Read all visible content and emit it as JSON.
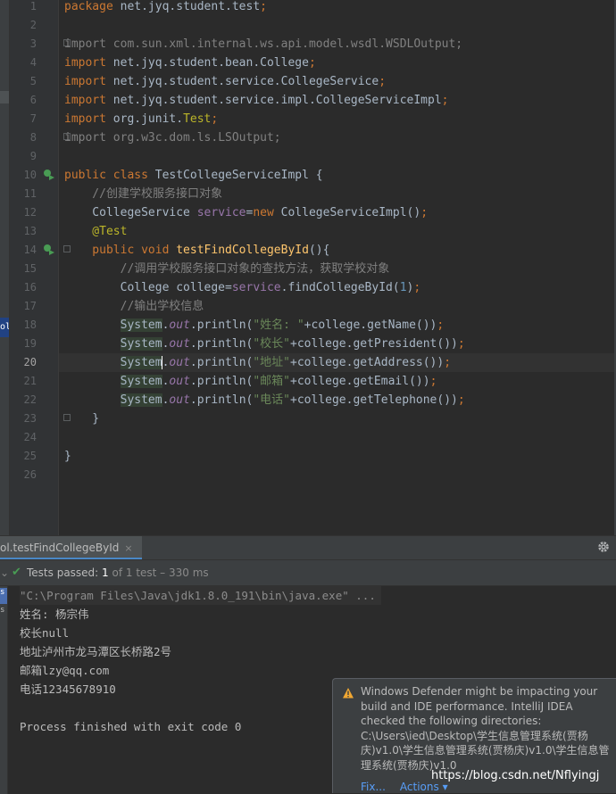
{
  "editor": {
    "line_numbers": [
      "1",
      "2",
      "3",
      "4",
      "5",
      "6",
      "7",
      "8",
      "9",
      "10",
      "11",
      "12",
      "13",
      "14",
      "15",
      "16",
      "17",
      "18",
      "19",
      "20",
      "21",
      "22",
      "23",
      "24",
      "25",
      "26"
    ],
    "current_line": "20",
    "code": {
      "l1_kw": "package",
      "l1_rest": " net.jyq.student.test",
      "l1_semi": ";",
      "l3_kw": "import",
      "l3_rest": " com.sun.xml.internal.ws.api.model.wsdl.WSDLOutput;",
      "l4_kw": "import",
      "l4_rest": " net.jyq.student.bean.College",
      "l4_semi": ";",
      "l5_kw": "import",
      "l5_rest": " net.jyq.student.service.CollegeService",
      "l5_semi": ";",
      "l6_kw": "import",
      "l6_rest": " net.jyq.student.service.impl.CollegeServiceImpl",
      "l6_semi": ";",
      "l7_kw": "import",
      "l7_rest": " org.junit.",
      "l7_ann": "Test",
      "l7_semi": ";",
      "l8_kw": "import",
      "l8_rest": " org.w3c.dom.ls.LSOutput;",
      "l10_kw": "public class",
      "l10_rest": " TestCollegeServiceImpl {",
      "l11_cmt": "    //创建学校服务接口对象",
      "l12_a": "    CollegeService ",
      "l12_fld": "service",
      "l12_b": "=",
      "l12_kw": "new",
      "l12_c": " CollegeServiceImpl()",
      "l12_semi": ";",
      "l13_ann": "    @Test",
      "l14_kw": "    public void",
      "l14_sp": " ",
      "l14_fn": "testFindCollegeById",
      "l14_rest": "(){",
      "l15_cmt": "        //调用学校服务接口对象的查找方法，获取学校对象",
      "l16_a": "        College college=",
      "l16_fld": "service",
      "l16_b": ".findCollegeById(",
      "l16_num": "1",
      "l16_c": ")",
      "l16_semi": ";",
      "l17_cmt": "        //输出学校信息",
      "l18_ind": "        ",
      "l18_sys": "System",
      "l18_dot": ".",
      "l18_out": "out",
      "l18_a": ".println(",
      "l18_str": "\"姓名: \"",
      "l18_b": "+college.getName())",
      "l18_semi": ";",
      "l19_ind": "        ",
      "l19_sys": "System",
      "l19_dot": ".",
      "l19_out": "out",
      "l19_a": ".println(",
      "l19_str": "\"校长\"",
      "l19_b": "+college.getPresident())",
      "l19_semi": ";",
      "l20_ind": "        ",
      "l20_sys": "System",
      "l20_dot": ".",
      "l20_out": "out",
      "l20_a": ".println(",
      "l20_str": "\"地址\"",
      "l20_b": "+college.getAddress())",
      "l20_semi": ";",
      "l21_ind": "        ",
      "l21_sys": "System",
      "l21_dot": ".",
      "l21_out": "out",
      "l21_a": ".println(",
      "l21_str": "\"邮箱\"",
      "l21_b": "+college.getEmail())",
      "l21_semi": ";",
      "l22_ind": "        ",
      "l22_sys": "System",
      "l22_dot": ".",
      "l22_out": "out",
      "l22_a": ".println(",
      "l22_str": "\"电话\"",
      "l22_b": "+college.getTelephone())",
      "l22_semi": ";",
      "l23": "    }",
      "l25": "}"
    }
  },
  "left_strip": {
    "label": "ol"
  },
  "run_panel": {
    "tab_label": "ol.testFindCollegeById",
    "tab_close": "×",
    "status": {
      "passed": "Tests passed: ",
      "count": "1",
      "of": " of 1 test – 330 ms"
    },
    "left_items": [
      "s",
      "s"
    ],
    "console": [
      "\"C:\\Program Files\\Java\\jdk1.8.0_191\\bin\\java.exe\" ...",
      "姓名: 杨宗伟",
      "校长null",
      "地址泸州市龙马潭区长桥路2号",
      "邮箱lzy@qq.com",
      "电话12345678910",
      "",
      "Process finished with exit code 0"
    ]
  },
  "notification": {
    "text": "Windows Defender might be impacting your build and IDE performance. IntelliJ IDEA checked the following directories: C:\\Users\\ied\\Desktop\\学生信息管理系统(贾杨庆)v1.0\\学生信息管理系统(贾杨庆)v1.0\\学生信息管理系统(贾杨庆)v1.0",
    "action_fix": "Fix...",
    "action_actions": "Actions ▾"
  },
  "watermark": "https://blog.csdn.net/Nflyingj",
  "colors": {
    "background": "#2b2b2b",
    "keyword": "#cc7832",
    "string": "#6a8759",
    "field": "#9876aa",
    "function": "#ffc66d",
    "comment": "#808080",
    "annotation": "#bbb529",
    "number": "#6897bb",
    "pass": "#499c54",
    "link": "#589df6"
  },
  "icons": [
    "run-test-icon",
    "fold-icon",
    "close-icon",
    "settings-icon",
    "chevron-down-icon",
    "check-icon",
    "warning-icon"
  ]
}
